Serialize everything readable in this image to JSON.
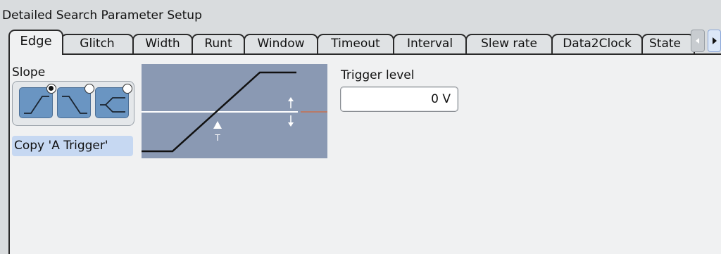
{
  "window": {
    "title": "Detailed Search Parameter Setup"
  },
  "tabs": [
    {
      "label": "Edge",
      "active": true
    },
    {
      "label": "Glitch"
    },
    {
      "label": "Width"
    },
    {
      "label": "Runt"
    },
    {
      "label": "Window"
    },
    {
      "label": "Timeout"
    },
    {
      "label": "Interval"
    },
    {
      "label": "Slew rate"
    },
    {
      "label": "Data2Clock"
    },
    {
      "label": "State"
    }
  ],
  "slope": {
    "label": "Slope",
    "options": [
      {
        "name": "rising",
        "icon": "rising-edge-icon",
        "selected": true
      },
      {
        "name": "falling",
        "icon": "falling-edge-icon",
        "selected": false
      },
      {
        "name": "either",
        "icon": "either-edge-icon",
        "selected": false
      }
    ]
  },
  "copy_button": {
    "label": "Copy 'A Trigger'"
  },
  "diagram": {
    "marker_label": "T"
  },
  "trigger_level": {
    "label": "Trigger level",
    "value": "0 V"
  },
  "colors": {
    "diagram_bg": "#8a99b3",
    "slope_button": "#6a95c2",
    "copy_button": "#c6d8f2",
    "level_tick": "#c87050"
  }
}
